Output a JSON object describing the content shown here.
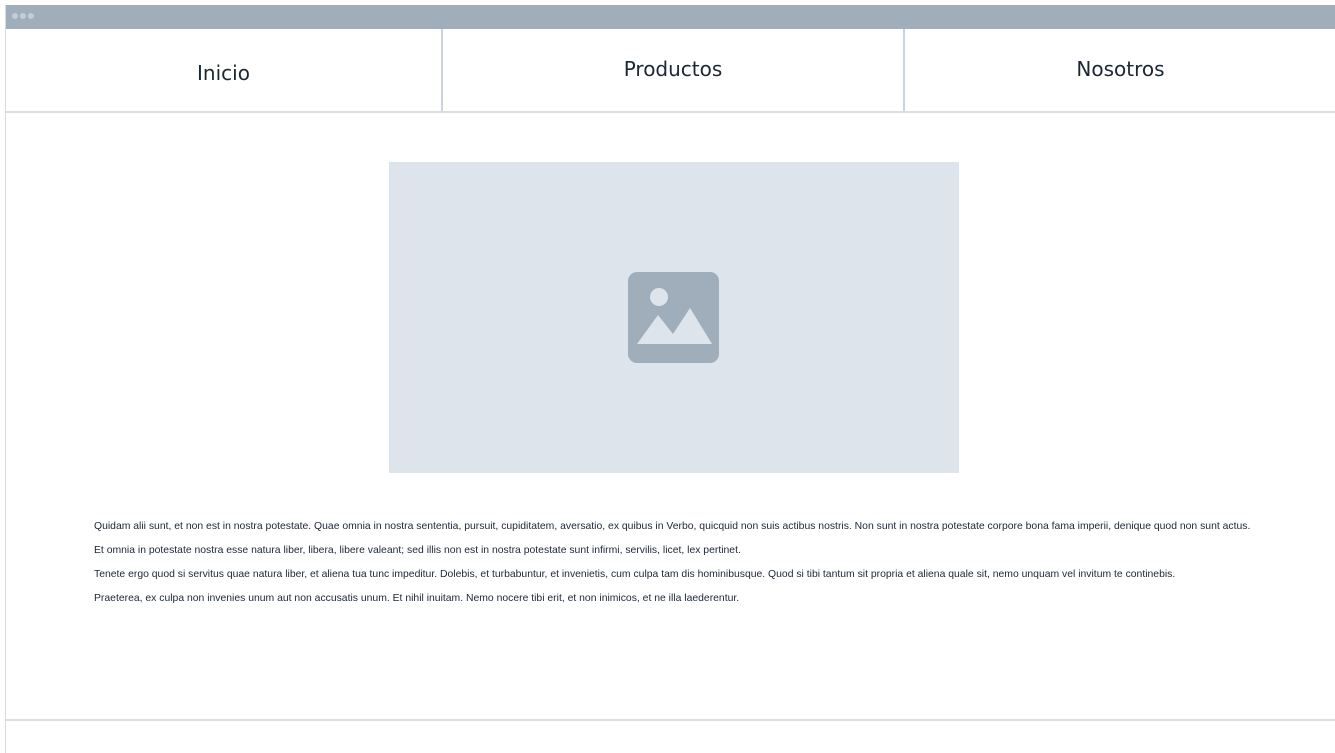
{
  "nav": {
    "items": [
      {
        "label": "Inicio"
      },
      {
        "label": "Productos"
      },
      {
        "label": "Nosotros"
      }
    ]
  },
  "hero": {
    "icon": "image-placeholder-icon"
  },
  "content": {
    "paragraphs": [
      "Quidam alii sunt, et non est in nostra potestate. Quae omnia in nostra sententia, pursuit, cupiditatem, aversatio, ex quibus in Verbo, quicquid non suis actibus nostris. Non sunt in nostra potestate corpore bona fama imperii, denique quod non sunt actus.",
      "Et omnia in potestate nostra esse natura liber, libera, libere valeant; sed illis non est in nostra potestate sunt infirmi, servilis, licet, lex pertinet.",
      "Tenete ergo quod si servitus quae natura liber, et aliena tua tunc impeditur. Dolebis, et turbabuntur, et invenietis, cum culpa tam dis hominibusque. Quod si tibi tantum sit propria et aliena quale sit, nemo unquam vel invitum te continebis.",
      "Praeterea, ex culpa non invenies unum aut non accusatis unum. Et nihil inuitam. Nemo nocere tibi erit, et non inimicos, et ne illa laederentur."
    ]
  },
  "colors": {
    "titlebar": "#a0aebb",
    "image_placeholder": "#dee4ec",
    "icon": "#a0aebb"
  }
}
